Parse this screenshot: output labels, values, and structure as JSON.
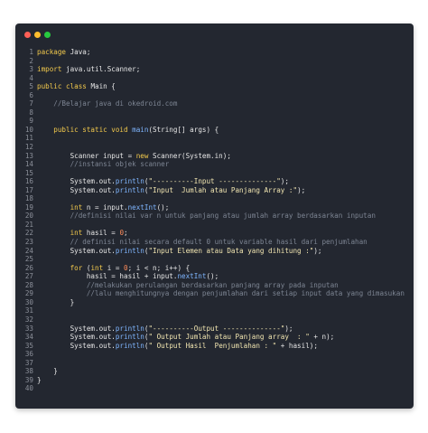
{
  "window": {
    "dots": [
      {
        "name": "close-dot",
        "color": "#ff5f56"
      },
      {
        "name": "minimize-dot",
        "color": "#ffbd2e"
      },
      {
        "name": "maximize-dot",
        "color": "#27c93f"
      }
    ]
  },
  "code": {
    "lines": [
      {
        "n": "1",
        "tokens": [
          {
            "t": "package ",
            "c": "kw"
          },
          {
            "t": "Java;",
            "c": "pl"
          }
        ]
      },
      {
        "n": "2",
        "tokens": []
      },
      {
        "n": "3",
        "tokens": [
          {
            "t": "import ",
            "c": "kw"
          },
          {
            "t": "java.util.Scanner;",
            "c": "pl"
          }
        ]
      },
      {
        "n": "4",
        "tokens": []
      },
      {
        "n": "5",
        "tokens": [
          {
            "t": "public class ",
            "c": "kw"
          },
          {
            "t": "Main {",
            "c": "pl"
          }
        ]
      },
      {
        "n": "6",
        "tokens": []
      },
      {
        "n": "7",
        "tokens": [
          {
            "t": "    //Belajar java di okedroid.com",
            "c": "cm"
          }
        ]
      },
      {
        "n": "8",
        "tokens": []
      },
      {
        "n": "9",
        "tokens": []
      },
      {
        "n": "10",
        "tokens": [
          {
            "t": "    public static void ",
            "c": "kw"
          },
          {
            "t": "main",
            "c": "mt"
          },
          {
            "t": "(String[] args) {",
            "c": "pl"
          }
        ]
      },
      {
        "n": "11",
        "tokens": []
      },
      {
        "n": "12",
        "tokens": []
      },
      {
        "n": "13",
        "tokens": [
          {
            "t": "        Scanner input = ",
            "c": "pl"
          },
          {
            "t": "new ",
            "c": "kw"
          },
          {
            "t": "Scanner(System.in);",
            "c": "pl"
          }
        ]
      },
      {
        "n": "14",
        "tokens": [
          {
            "t": "        //instansi objek scanner",
            "c": "cm"
          }
        ]
      },
      {
        "n": "15",
        "tokens": []
      },
      {
        "n": "16",
        "tokens": [
          {
            "t": "        System.out.",
            "c": "pl"
          },
          {
            "t": "println",
            "c": "mt"
          },
          {
            "t": "(",
            "c": "pl"
          },
          {
            "t": "\"----------Input --------------\"",
            "c": "st"
          },
          {
            "t": ");",
            "c": "pl"
          }
        ]
      },
      {
        "n": "17",
        "tokens": [
          {
            "t": "        System.out.",
            "c": "pl"
          },
          {
            "t": "println",
            "c": "mt"
          },
          {
            "t": "(",
            "c": "pl"
          },
          {
            "t": "\"Input  Jumlah atau Panjang Array :\"",
            "c": "st"
          },
          {
            "t": ");",
            "c": "pl"
          }
        ]
      },
      {
        "n": "18",
        "tokens": []
      },
      {
        "n": "19",
        "tokens": [
          {
            "t": "        int ",
            "c": "kw"
          },
          {
            "t": "n = input.",
            "c": "pl"
          },
          {
            "t": "nextInt",
            "c": "mt"
          },
          {
            "t": "();",
            "c": "pl"
          }
        ]
      },
      {
        "n": "20",
        "tokens": [
          {
            "t": "        //definisi nilai var n untuk panjang atau jumlah array berdasarkan inputan",
            "c": "cm"
          }
        ]
      },
      {
        "n": "21",
        "tokens": []
      },
      {
        "n": "22",
        "tokens": [
          {
            "t": "        int ",
            "c": "kw"
          },
          {
            "t": "hasil = ",
            "c": "pl"
          },
          {
            "t": "0",
            "c": "num"
          },
          {
            "t": ";",
            "c": "pl"
          }
        ]
      },
      {
        "n": "23",
        "tokens": [
          {
            "t": "        // definisi nilai secara default 0 untuk variable hasil dari penjumlahan",
            "c": "cm"
          }
        ]
      },
      {
        "n": "24",
        "tokens": [
          {
            "t": "        System.out.",
            "c": "pl"
          },
          {
            "t": "println",
            "c": "mt"
          },
          {
            "t": "(",
            "c": "pl"
          },
          {
            "t": "\"Input Elemen atau Data yang dihitung :\"",
            "c": "st"
          },
          {
            "t": ");",
            "c": "pl"
          }
        ]
      },
      {
        "n": "25",
        "tokens": []
      },
      {
        "n": "26",
        "tokens": [
          {
            "t": "        for ",
            "c": "kw"
          },
          {
            "t": "(",
            "c": "pl"
          },
          {
            "t": "int ",
            "c": "kw"
          },
          {
            "t": "i = ",
            "c": "pl"
          },
          {
            "t": "0",
            "c": "num"
          },
          {
            "t": "; i < n; i++) {",
            "c": "pl"
          }
        ]
      },
      {
        "n": "27",
        "tokens": [
          {
            "t": "            hasil = hasil + input.",
            "c": "pl"
          },
          {
            "t": "nextInt",
            "c": "mt"
          },
          {
            "t": "();",
            "c": "pl"
          }
        ]
      },
      {
        "n": "28",
        "tokens": [
          {
            "t": "            //melakukan perulangan berdasarkan panjang array pada inputan",
            "c": "cm"
          }
        ]
      },
      {
        "n": "29",
        "tokens": [
          {
            "t": "            //lalu menghitungnya dengan penjumlahan dari setiap input data yang dimasukan",
            "c": "cm"
          }
        ]
      },
      {
        "n": "30",
        "tokens": [
          {
            "t": "        }",
            "c": "pl"
          }
        ]
      },
      {
        "n": "31",
        "tokens": []
      },
      {
        "n": "32",
        "tokens": []
      },
      {
        "n": "33",
        "tokens": [
          {
            "t": "        System.out.",
            "c": "pl"
          },
          {
            "t": "println",
            "c": "mt"
          },
          {
            "t": "(",
            "c": "pl"
          },
          {
            "t": "\"----------Output --------------\"",
            "c": "st"
          },
          {
            "t": ");",
            "c": "pl"
          }
        ]
      },
      {
        "n": "34",
        "tokens": [
          {
            "t": "        System.out.",
            "c": "pl"
          },
          {
            "t": "println",
            "c": "mt"
          },
          {
            "t": "(",
            "c": "pl"
          },
          {
            "t": "\" Output Jumlah atau Panjang array  : \"",
            "c": "st"
          },
          {
            "t": " + n);",
            "c": "pl"
          }
        ]
      },
      {
        "n": "35",
        "tokens": [
          {
            "t": "        System.out.",
            "c": "pl"
          },
          {
            "t": "println",
            "c": "mt"
          },
          {
            "t": "(",
            "c": "pl"
          },
          {
            "t": "\" Output Hasil  Penjumlahan : \"",
            "c": "st"
          },
          {
            "t": " + hasil);",
            "c": "pl"
          }
        ]
      },
      {
        "n": "36",
        "tokens": []
      },
      {
        "n": "37",
        "tokens": []
      },
      {
        "n": "38",
        "tokens": [
          {
            "t": "    }",
            "c": "pl"
          }
        ]
      },
      {
        "n": "39",
        "tokens": [
          {
            "t": "}",
            "c": "pl"
          }
        ]
      },
      {
        "n": "40",
        "tokens": []
      }
    ]
  }
}
